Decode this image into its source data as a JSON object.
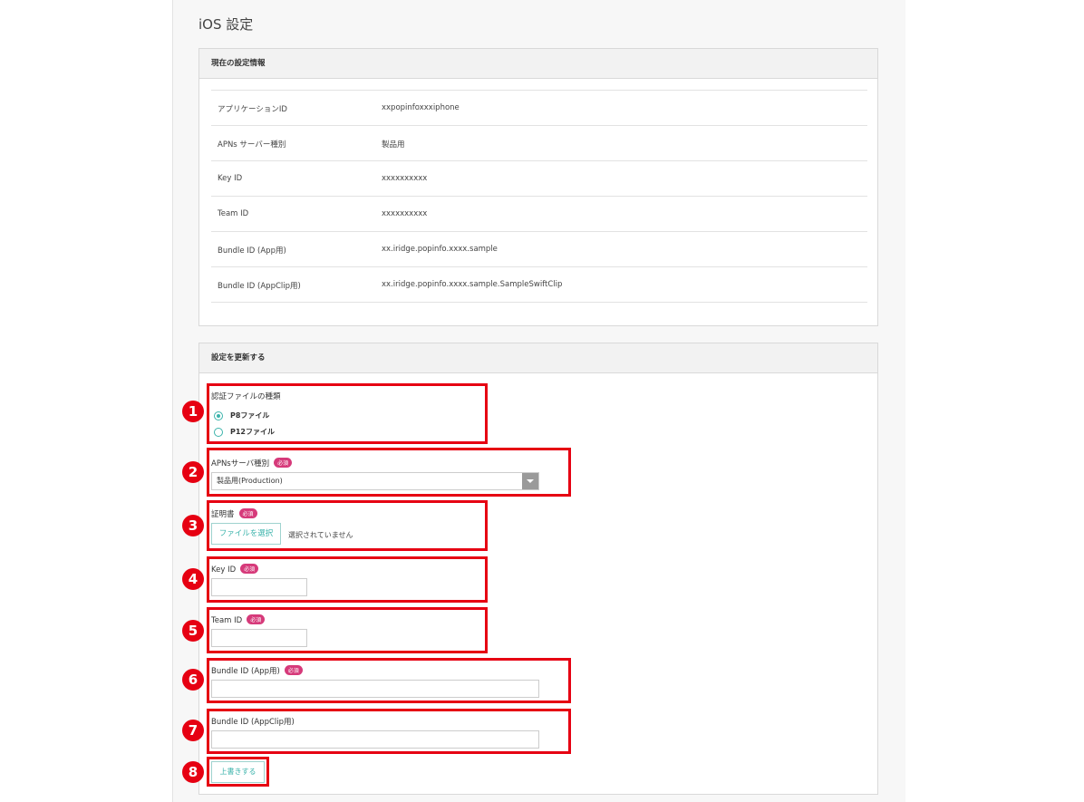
{
  "page_title": "iOS 設定",
  "current_info": {
    "header": "現在の設定情報",
    "rows": [
      {
        "key": "アプリケーションID",
        "value": "xxpopinfoxxxiphone"
      },
      {
        "key": "APNs サーバー種別",
        "value": "製品用"
      },
      {
        "key": "Key ID",
        "value": "xxxxxxxxxx"
      },
      {
        "key": "Team ID",
        "value": "xxxxxxxxxx"
      },
      {
        "key": "Bundle ID (App用)",
        "value": "xx.iridge.popinfo.xxxx.sample"
      },
      {
        "key": "Bundle ID (AppClip用)",
        "value": "xx.iridge.popinfo.xxxx.sample.SampleSwiftClip"
      }
    ]
  },
  "update": {
    "header": "設定を更新する",
    "required_badge": "必須",
    "cert_type": {
      "label": "認証ファイルの種類",
      "options": [
        {
          "label": "P8ファイル",
          "selected": true
        },
        {
          "label": "P12ファイル",
          "selected": false
        }
      ]
    },
    "apns_server": {
      "label": "APNsサーバ種別",
      "selected": "製品用(Production)"
    },
    "certificate": {
      "label": "証明書",
      "button": "ファイルを選択",
      "status": "選択されていません"
    },
    "key_id": {
      "label": "Key ID",
      "value": ""
    },
    "team_id": {
      "label": "Team ID",
      "value": ""
    },
    "bundle_app": {
      "label": "Bundle ID (App用)",
      "value": ""
    },
    "bundle_appclip": {
      "label": "Bundle ID (AppClip用)",
      "value": ""
    },
    "submit": "上書きする"
  },
  "annotations": [
    "1",
    "2",
    "3",
    "4",
    "5",
    "6",
    "7",
    "8"
  ],
  "colors": {
    "accent": "#3bb3ab",
    "required": "#d63a7a",
    "annotation": "#e60012"
  }
}
